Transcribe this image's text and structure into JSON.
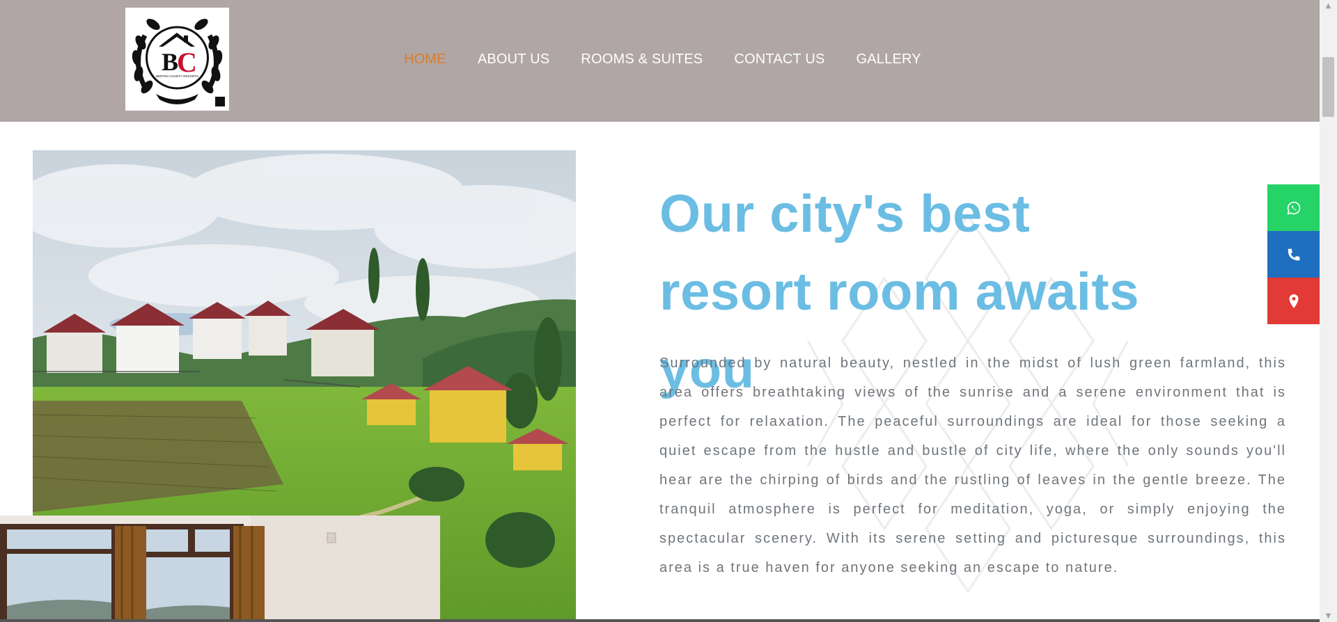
{
  "logo": {
    "monogram_b": "B",
    "monogram_c": "C",
    "caption": "BERTINI COUNTY RESORTS"
  },
  "nav": [
    {
      "label": "HOME",
      "active": true
    },
    {
      "label": "ABOUT US",
      "active": false
    },
    {
      "label": "ROOMS & SUITES",
      "active": false
    },
    {
      "label": "CONTACT US",
      "active": false
    },
    {
      "label": "GALLERY",
      "active": false
    }
  ],
  "hero": {
    "headline": "Our city's best resort room awaits you",
    "paragraph": "Surrounded by natural beauty, nestled in the midst of lush green farmland, this area offers breathtaking views of the sunrise and a serene environment that is perfect for relaxation. The peaceful surroundings are ideal for those seeking a quiet escape from the hustle and bustle of city life, where the only sounds you'll hear are the chirping of birds and the rustling of leaves in the gentle breeze. The tranquil atmosphere is perfect for meditation, yoga, or simply enjoying the spectacular scenery. With its serene setting and picturesque surroundings, this area is a true haven for anyone seeking an escape to nature."
  },
  "side_buttons": [
    {
      "name": "whatsapp-icon",
      "color": "#25d366"
    },
    {
      "name": "phone-icon",
      "color": "#1f6fc0"
    },
    {
      "name": "location-pin-icon",
      "color": "#e23a36"
    }
  ],
  "colors": {
    "header_bg": "#b0a6a6",
    "nav_active": "#d97d2a",
    "headline": "#6bbde3",
    "body_text": "#6f757b"
  }
}
